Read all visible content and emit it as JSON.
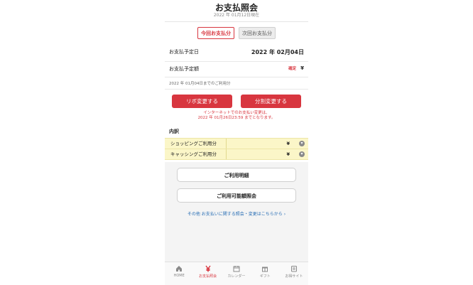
{
  "header": {
    "title": "お支払照会",
    "subtitle": "2022 年 01月12日現在"
  },
  "tabs": [
    {
      "label": "今回お支払分",
      "active": true
    },
    {
      "label": "次回お支払分",
      "active": false
    }
  ],
  "payment": {
    "date_label": "お支払予定日",
    "date_value": "2022 年 02月04日",
    "amount_label": "お支払予定額",
    "status_badge": "確定",
    "amount_value": "¥",
    "usage_note": "2022 年 01月04日までのご利用分"
  },
  "actions": {
    "revo_button": "リボ変更する",
    "split_button": "分割変更する",
    "notice_line1": "インターネットでのお支払い変更は、",
    "notice_line2": "2022 年 01月26日23:59 までとなります。"
  },
  "breakdown": {
    "title": "内訳",
    "items": [
      {
        "label": "ショッピングご利用分",
        "value": "¥"
      },
      {
        "label": "キャッシングご利用分",
        "value": "¥"
      }
    ]
  },
  "links": {
    "statement_button": "ご利用明細",
    "available_button": "ご利用可能額照会",
    "other_link": "その他 お支払いに関する照会・変更はこちらから"
  },
  "bottom_nav": [
    {
      "label": "HOME",
      "icon": "home-icon",
      "active": false
    },
    {
      "label": "お支払照会",
      "icon": "yen-icon",
      "active": true
    },
    {
      "label": "カレンダー",
      "icon": "calendar-icon",
      "active": false
    },
    {
      "label": "ギフト",
      "icon": "gift-icon",
      "active": false
    },
    {
      "label": "お得サイト",
      "icon": "shop-icon",
      "active": false
    }
  ],
  "colors": {
    "accent": "#d8363f",
    "link": "#2a6fb5",
    "highlight": "#fbf6c8"
  }
}
